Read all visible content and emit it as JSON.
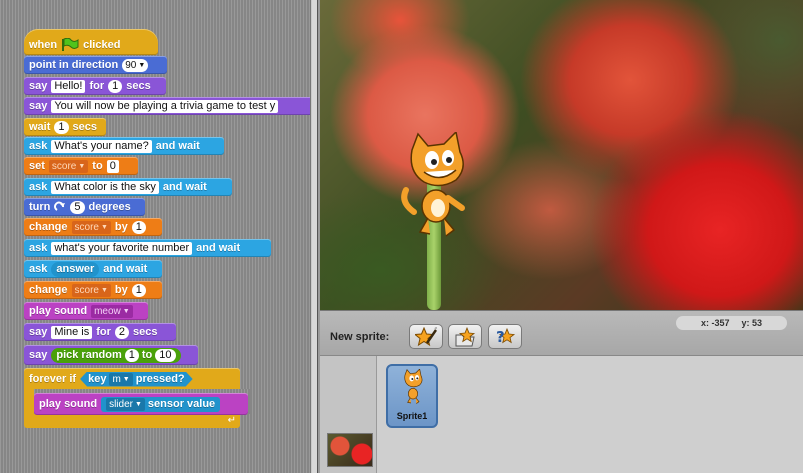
{
  "scripts": {
    "hat": {
      "prefix": "when",
      "suffix": "clicked"
    },
    "point": {
      "label": "point in direction",
      "value": "90"
    },
    "say1": {
      "label": "say",
      "text": "Hello!",
      "for": "for",
      "secs_value": "1",
      "secs": "secs"
    },
    "say2": {
      "label": "say",
      "text": "You will now be playing a trivia game to test y"
    },
    "wait1": {
      "label": "wait",
      "value": "1",
      "secs": "secs"
    },
    "ask1": {
      "label": "ask",
      "text": "What's your name?",
      "suffix": "and wait"
    },
    "set": {
      "label": "set",
      "var": "score",
      "to": "to",
      "value": "0"
    },
    "ask2": {
      "label": "ask",
      "text": "What color is the sky",
      "suffix": "and wait"
    },
    "turn": {
      "label": "turn",
      "value": "5",
      "suffix": "degrees"
    },
    "change1": {
      "label": "change",
      "var": "score",
      "by": "by",
      "value": "1"
    },
    "ask3": {
      "label": "ask",
      "text": "what's your favorite number",
      "suffix": "and wait"
    },
    "ask4": {
      "label": "ask",
      "reporter": "answer",
      "suffix": "and wait"
    },
    "change2": {
      "label": "change",
      "var": "score",
      "by": "by",
      "value": "1"
    },
    "play1": {
      "label": "play sound",
      "sound": "meow"
    },
    "say3": {
      "label": "say",
      "text": "Mine is",
      "for": "for",
      "secs_value": "2",
      "secs": "secs"
    },
    "say4": {
      "label": "say",
      "op": "pick random",
      "from": "1",
      "to": "to",
      "upto": "10"
    },
    "forever": {
      "label": "forever if",
      "key": "key",
      "key_value": "m",
      "pressed": "pressed?"
    },
    "play2": {
      "label": "play sound",
      "sensor": "slider",
      "suffix": "sensor value"
    }
  },
  "sprite_bar": {
    "x_label": "x:",
    "x_value": "-357",
    "y_label": "y:",
    "y_value": "53",
    "new_sprite_label": "New sprite:"
  },
  "sprite_list": {
    "sprite1_name": "Sprite1"
  },
  "icons": [
    "green-flag-icon",
    "turn-right-icon",
    "paint-new-sprite-icon",
    "choose-sprite-file-icon",
    "surprise-sprite-icon",
    "loop-arrow-icon"
  ],
  "colors": {
    "motion": "#4a6cd4",
    "looks": "#8a55d7",
    "control": "#e1a91a",
    "sensing": "#2ca5e2",
    "variables": "#ee7d16",
    "sound": "#bb42c3",
    "operators": "#5cb712"
  }
}
